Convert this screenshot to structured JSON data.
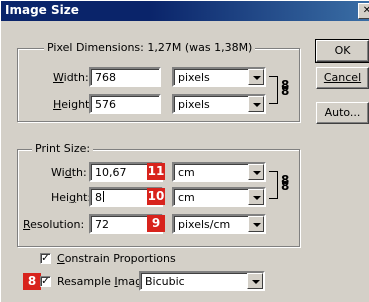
{
  "title": "Image Size",
  "pixel_dimensions": {
    "legend": "Pixel Dimensions:  1,27M (was 1,38M)",
    "width_label": "Width:",
    "width_value": "768",
    "width_unit": "pixels",
    "height_label": "Height:",
    "height_value": "576",
    "height_unit": "pixels"
  },
  "print_size": {
    "legend": "Print Size:",
    "width_label": "Width:",
    "width_value": "10,67",
    "width_unit": "cm",
    "height_label": "Height:",
    "height_value": "8",
    "height_unit": "cm",
    "resolution_label": "Resolution:",
    "resolution_value": "72",
    "resolution_unit": "pixels/cm"
  },
  "options": {
    "constrain_label": "Constrain Proportions",
    "constrain_checked": true,
    "resample_label": "Resample Image:",
    "resample_checked": true,
    "resample_method": "Bicubic"
  },
  "buttons": {
    "ok": "OK",
    "cancel": "Cancel",
    "auto": "Auto..."
  },
  "badges": {
    "width": "11",
    "height": "10",
    "resolution": "9",
    "resample": "8"
  },
  "colors": {
    "badge": "#d8231c",
    "dialog": "#d4d0c8",
    "titlebar": "#0a246a"
  }
}
